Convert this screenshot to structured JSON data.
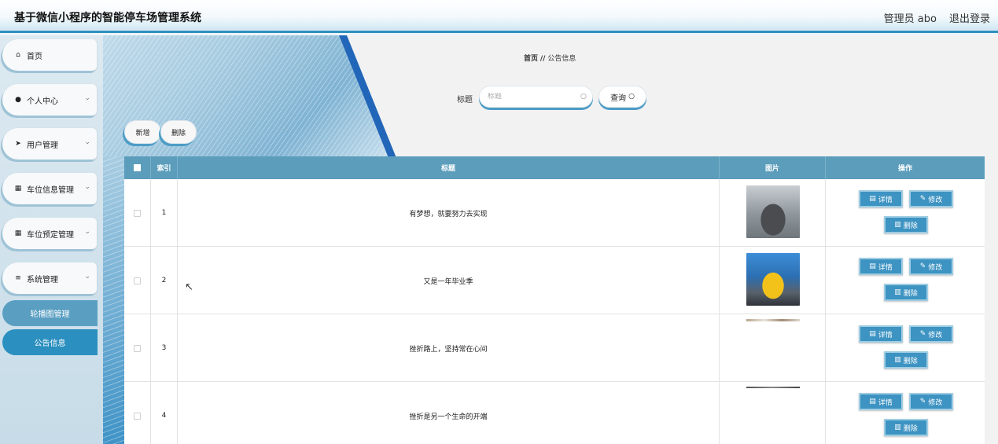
{
  "header": {
    "app_title": "基于微信小程序的智能停车场管理系统",
    "user_label": "管理员 abo",
    "logout_label": "退出登录"
  },
  "sidebar": {
    "items": [
      {
        "label": "首页",
        "icon": "home-icon",
        "expandable": false
      },
      {
        "label": "个人中心",
        "icon": "user-icon",
        "expandable": true
      },
      {
        "label": "用户管理",
        "icon": "send-icon",
        "expandable": true
      },
      {
        "label": "车位信息管理",
        "icon": "grid-icon",
        "expandable": true
      },
      {
        "label": "车位预定管理",
        "icon": "grid-icon",
        "expandable": true
      },
      {
        "label": "系统管理",
        "icon": "list-icon",
        "expandable": true
      }
    ],
    "sub_items": [
      {
        "label": "轮播图管理",
        "active": false
      },
      {
        "label": "公告信息",
        "active": true
      }
    ]
  },
  "breadcrumb": {
    "home": "首页",
    "separator": "//",
    "current": "公告信息"
  },
  "search": {
    "label": "标题",
    "placeholder": "标题",
    "value": "",
    "button_label": "查询"
  },
  "toolbar": {
    "add_label": "新增",
    "delete_label": "删除"
  },
  "table": {
    "columns": [
      "索引",
      "标题",
      "图片",
      "操作"
    ],
    "rows": [
      {
        "index": "1",
        "title": "有梦想，就要努力去实现",
        "image": "dark-sports-car-photo"
      },
      {
        "index": "2",
        "title": "又是一年毕业季",
        "image": "yellow-sports-car-photo"
      },
      {
        "index": "3",
        "title": "挫折路上，坚持常在心间",
        "image": "cropped-photo"
      },
      {
        "index": "4",
        "title": "挫折是另一个生命的开端",
        "image": "cropped-photo"
      }
    ],
    "actions": {
      "detail": "详情",
      "edit": "修改",
      "delete": "删除"
    }
  },
  "colors": {
    "accent": "#3d93c2",
    "table_header": "#5b9dbb",
    "active_menu": "#2b8fbf"
  }
}
